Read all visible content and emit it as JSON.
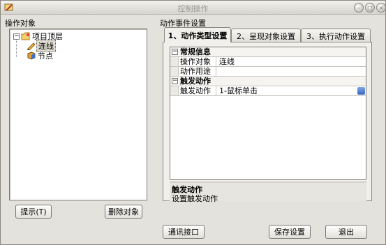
{
  "window": {
    "title": "控制操作"
  },
  "left": {
    "group_label": "操作对象",
    "tree": [
      {
        "label": "项目顶层"
      },
      {
        "label": "连线"
      },
      {
        "label": "节点"
      }
    ],
    "tip_button": "提示(T)",
    "delete_button": "删除对象"
  },
  "right": {
    "group_label": "动作事件设置",
    "tabs": [
      {
        "label": "1、动作类型设置"
      },
      {
        "label": "2、呈现对象设置"
      },
      {
        "label": "3、执行动作设置"
      }
    ],
    "grid": {
      "cat1": "常规信息",
      "row1_name": "操作对象",
      "row1_value": "连线",
      "row2_name": "动作用途",
      "row2_value": "",
      "cat2": "触发动作",
      "row3_name": "触发动作",
      "row3_value": "1-鼠标单击"
    },
    "desc_title": "触发动作",
    "desc_text": "设置触发动作"
  },
  "bottom": {
    "comm_button": "通讯接口",
    "save_button": "保存设置",
    "exit_button": "退出"
  }
}
